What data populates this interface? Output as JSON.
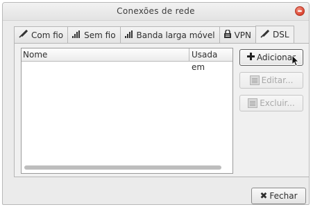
{
  "window": {
    "title": "Conexões de rede",
    "close_icon": "close-circle-icon"
  },
  "tabs": [
    {
      "label": "Com fio",
      "icon": "ethernet-plug-icon",
      "glyph": "✒"
    },
    {
      "label": "Sem fio",
      "icon": "wireless-signal-icon",
      "glyph": "ıl"
    },
    {
      "label": "Banda larga móvel",
      "icon": "mobile-signal-icon",
      "glyph": "ıl"
    },
    {
      "label": "VPN",
      "icon": "lock-icon",
      "glyph": "🔒"
    },
    {
      "label": "DSL",
      "icon": "dsl-plug-icon",
      "glyph": "✒",
      "active": true
    }
  ],
  "list": {
    "columns": [
      "Nome",
      "Usada em"
    ],
    "rows": []
  },
  "buttons": {
    "add": {
      "label": "Adicionar",
      "icon": "plus-icon",
      "enabled": true
    },
    "edit": {
      "label": "Editar...",
      "icon": "document-icon",
      "enabled": false
    },
    "delete": {
      "label": "Excluir...",
      "icon": "document-icon",
      "enabled": false
    },
    "close": {
      "label": "Fechar",
      "icon": "x-icon"
    }
  },
  "colors": {
    "window_bg": "#ebebeb",
    "close_button": "#d9412e"
  }
}
